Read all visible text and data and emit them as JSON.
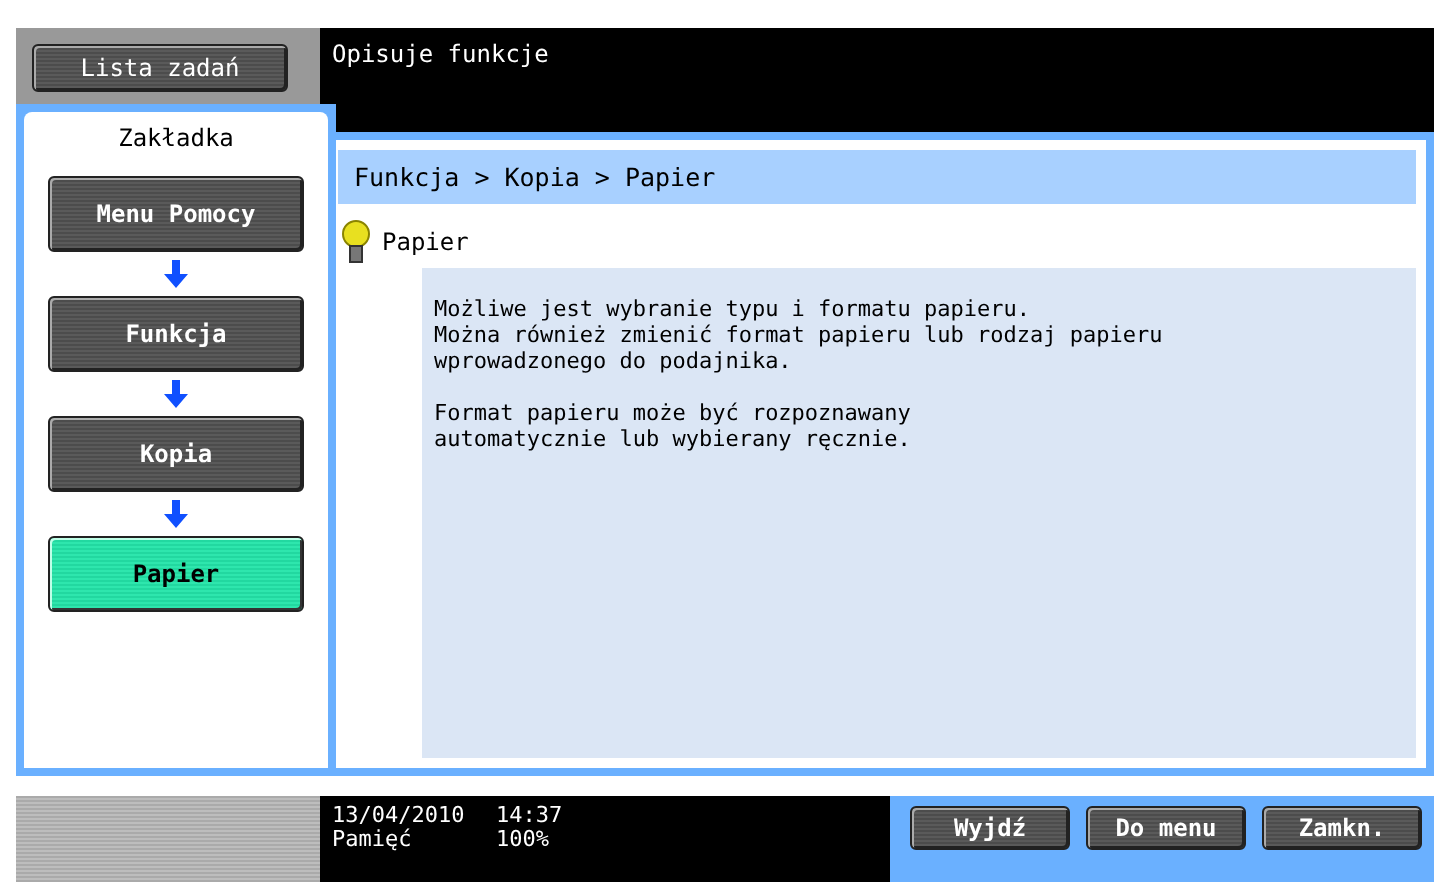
{
  "header": {
    "job_list_button": "Lista zadań",
    "message": "Opisuje funkcje"
  },
  "sidebar": {
    "title": "Zakładka",
    "items": [
      {
        "label": "Menu Pomocy",
        "selected": false
      },
      {
        "label": "Funkcja",
        "selected": false
      },
      {
        "label": "Kopia",
        "selected": false
      },
      {
        "label": "Papier",
        "selected": true
      }
    ]
  },
  "breadcrumb": "Funkcja > Kopia > Papier",
  "topic": {
    "title": "Papier",
    "paragraphs": [
      "Możliwe jest wybranie typu i formatu papieru.\nMożna również zmienić format papieru lub rodzaj papieru\nwprowadzonego do podajnika.",
      "Format papieru może być rozpoznawany\nautomatycznie lub wybierany ręcznie."
    ]
  },
  "status_bar": {
    "date": "13/04/2010",
    "time": "14:37",
    "memory_label": "Pamięć",
    "memory_value": "100%"
  },
  "buttons": [
    "Wyjdź",
    "Do menu",
    "Zamkn."
  ]
}
